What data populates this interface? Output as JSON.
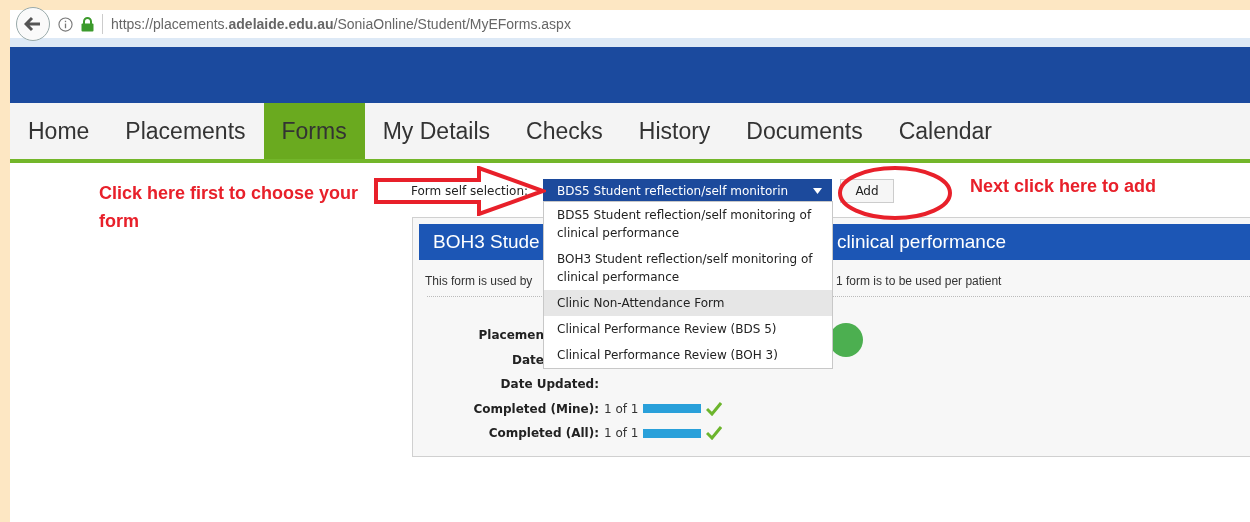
{
  "browser": {
    "url": "https://placements.**adelaide.edu.au**/SoniaOnline/Student/MyEForms.aspx"
  },
  "nav": [
    {
      "label": "Home",
      "selected": false
    },
    {
      "label": "Placements",
      "selected": false
    },
    {
      "label": "Forms",
      "selected": true
    },
    {
      "label": "My Details",
      "selected": false
    },
    {
      "label": "Checks",
      "selected": false
    },
    {
      "label": "History",
      "selected": false
    },
    {
      "label": "Documents",
      "selected": false
    },
    {
      "label": "Calendar",
      "selected": false
    }
  ],
  "annotations": {
    "first_step": "Click here first to choose your form",
    "next_step": "Next click here to add"
  },
  "form_selection": {
    "label": "Form self selection:",
    "value": "BDS5 Student reflection/self monitorin",
    "expanded": true,
    "options": [
      {
        "label": "BDS5 Student reflection/self monitoring of clinical performance",
        "selected": false
      },
      {
        "label": "BOH3 Student reflection/self monitoring of clinical performance",
        "selected": false
      },
      {
        "label": "Clinic Non-Attendance Form",
        "selected": true
      },
      {
        "label": "Clinical Performance Review (BDS 5)",
        "selected": false
      },
      {
        "label": "Clinical Performance Review (BOH 3)",
        "selected": false
      }
    ],
    "add_button": "Add"
  },
  "form_panel": {
    "title_start": "BOH3 Stude",
    "title_end": "clinical performance",
    "description_start": "This form is used by",
    "description_end": "1 form is to be used per patient",
    "fields": [
      {
        "label": "Placemen",
        "kind": "cut"
      },
      {
        "label": "Date",
        "kind": "cut"
      },
      {
        "label": "Date Updated:",
        "kind": "full"
      }
    ],
    "progress": [
      {
        "label": "Completed (Mine):",
        "value": "1 of 1",
        "level": 1,
        "complete": true
      },
      {
        "label": "Completed (All):",
        "value": "1 of 1",
        "level": 1,
        "complete": true
      }
    ]
  }
}
